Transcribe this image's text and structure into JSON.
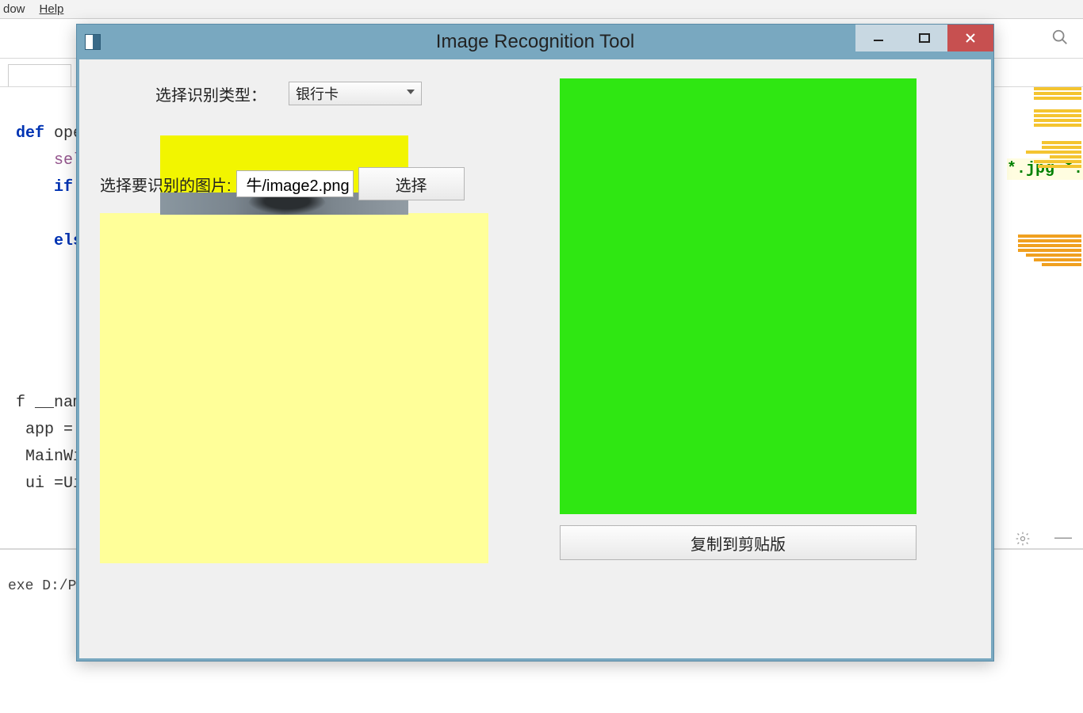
{
  "ide": {
    "menu": {
      "window": "dow",
      "help": "Help"
    },
    "code": {
      "l1": "def ope",
      "l2": "    self",
      "l3": "    if ",
      "l4": "    els",
      "l5": "f __name__",
      "l6": " app = Q",
      "l7": " MainWin",
      "l8": " ui =Ui "
    },
    "console": "exe D:/Pyw",
    "file_hint": "*.jpg *."
  },
  "win": {
    "title": "Image Recognition Tool",
    "type_label": "选择识别类型：",
    "type_value": "银行卡",
    "pick_label": "选择要识别的图片:",
    "path_value": "牛/image2.png",
    "pick_button": "选择",
    "copy_button": "复制到剪贴版"
  }
}
